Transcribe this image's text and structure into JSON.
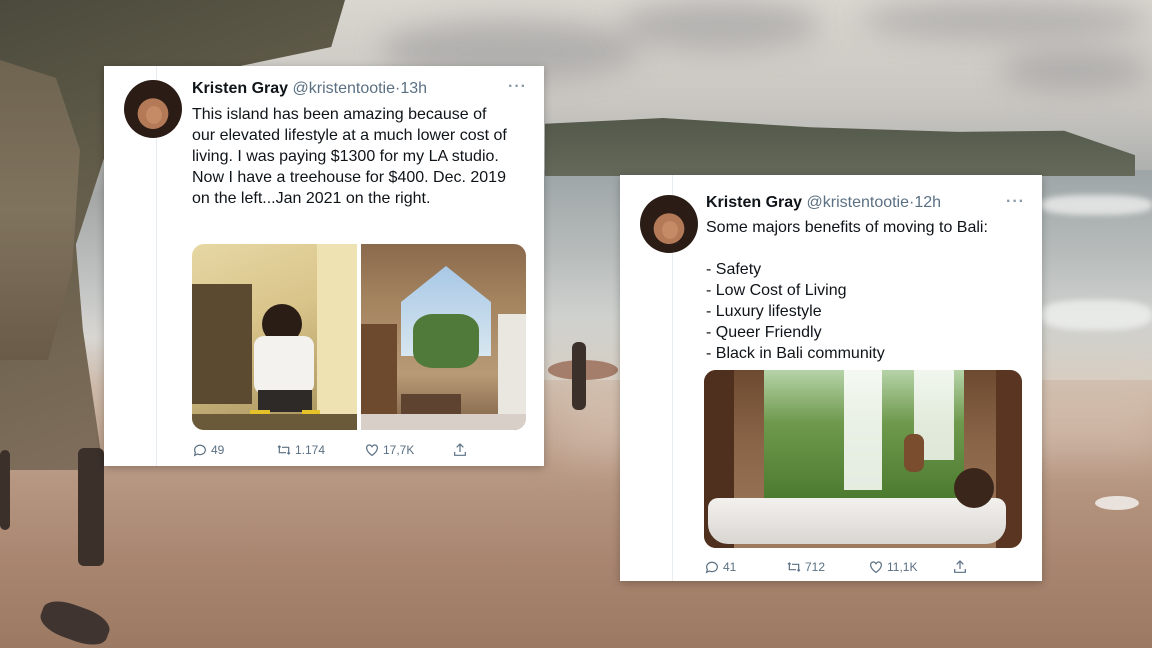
{
  "tweets": [
    {
      "name": "Kristen Gray",
      "handle": "@kristentootie",
      "separator": "·",
      "time": "13h",
      "more": "···",
      "text": "This island has been amazing because of our elevated lifestyle at a much lower cost of living. I was paying $1300 for my LA studio. Now I have a treehouse for $400. Dec. 2019 on the left...Jan 2021 on the right.",
      "replies": "49",
      "retweets": "1.174",
      "likes": "17,7K"
    },
    {
      "name": "Kristen Gray",
      "handle": "@kristentootie",
      "separator": "·",
      "time": "12h",
      "more": "···",
      "intro": "Some majors benefits of moving to Bali:",
      "benefits": [
        "- Safety",
        "- Low Cost of Living",
        "- Luxury lifestyle",
        "- Queer Friendly",
        "- Black in Bali community"
      ],
      "replies": "41",
      "retweets": "712",
      "likes": "11,1K"
    }
  ],
  "icons": [
    "more-icon",
    "reply-icon",
    "retweet-icon",
    "like-icon",
    "share-icon"
  ]
}
